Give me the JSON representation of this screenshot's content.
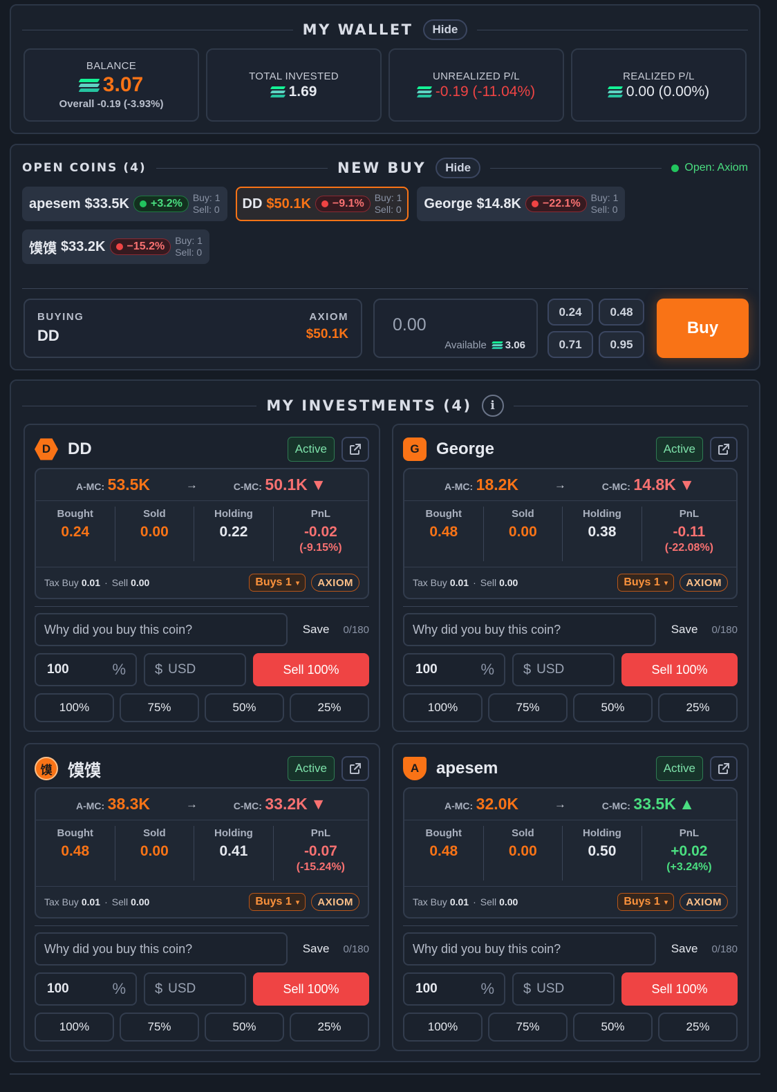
{
  "colors": {
    "accent": "#f97316",
    "negative": "#ef4444",
    "positive": "#22c55e",
    "background": "#151b24"
  },
  "wallet": {
    "title": "MY WALLET",
    "hide_label": "Hide",
    "balance": {
      "label": "BALANCE",
      "value": "3.07",
      "overall": "Overall -0.19 (-3.93%)"
    },
    "total_invested": {
      "label": "TOTAL INVESTED",
      "value": "1.69"
    },
    "unrealized": {
      "label": "UNREALIZED P/L",
      "value": "-0.19 (-11.04%)"
    },
    "realized": {
      "label": "REALIZED P/L",
      "value": "0.00 (0.00%)"
    }
  },
  "new_buy": {
    "open_coins_label": "OPEN COINS (4)",
    "title": "NEW BUY",
    "hide_label": "Hide",
    "status": "Open: Axiom",
    "coins": [
      {
        "name": "apesem",
        "mc": "$33.5K",
        "change": "+3.2%",
        "buy": "Buy: 1",
        "sell": "Sell: 0",
        "direction": "up",
        "selected": false
      },
      {
        "name": "DD",
        "mc": "$50.1K",
        "change": "−9.1%",
        "buy": "Buy: 1",
        "sell": "Sell: 0",
        "direction": "down",
        "selected": true
      },
      {
        "name": "George",
        "mc": "$14.8K",
        "change": "−22.1%",
        "buy": "Buy: 1",
        "sell": "Sell: 0",
        "direction": "down",
        "selected": false
      },
      {
        "name": "馍馍",
        "mc": "$33.2K",
        "change": "−15.2%",
        "buy": "Buy: 1",
        "sell": "Sell: 0",
        "direction": "down",
        "selected": false
      }
    ],
    "buying_label": "BUYING",
    "platform_label": "AXIOM",
    "buying_token": "DD",
    "buying_mc": "$50.1K",
    "amount_placeholder": "0.00",
    "available_label": "Available",
    "available_value": "3.06",
    "quick_amounts": [
      "0.24",
      "0.48",
      "0.71",
      "0.95"
    ],
    "buy_label": "Buy"
  },
  "investments": {
    "title": "MY INVESTMENTS (4)",
    "info_icon": "i",
    "labels": {
      "active": "Active",
      "a_mc": "A-MC:",
      "c_mc": "C-MC:",
      "bought": "Bought",
      "sold": "Sold",
      "holding": "Holding",
      "pnl": "PnL",
      "tax_buy": "Tax Buy",
      "sell": "Sell",
      "platform": "AXIOM",
      "note_placeholder": "Why did you buy this coin?",
      "save": "Save",
      "note_count": "0/180",
      "pct_unit": "%",
      "usd_symbol": "$",
      "usd": "USD",
      "sell_btn": "Sell 100%",
      "pct_options": [
        "100%",
        "75%",
        "50%",
        "25%"
      ]
    },
    "cards": [
      {
        "name": "DD",
        "icon_letter": "D",
        "a_mc": "53.5K",
        "c_mc": "50.1K",
        "trend": "down",
        "bought": "0.24",
        "sold": "0.00",
        "holding": "0.22",
        "pnl": "-0.02",
        "pnl_pct": "(-9.15%)",
        "tax_buy": "0.01",
        "tax_sell": "0.00",
        "buys": "Buys 1",
        "pct_value": "100"
      },
      {
        "name": "George",
        "icon_letter": "G",
        "a_mc": "18.2K",
        "c_mc": "14.8K",
        "trend": "down",
        "bought": "0.48",
        "sold": "0.00",
        "holding": "0.38",
        "pnl": "-0.11",
        "pnl_pct": "(-22.08%)",
        "tax_buy": "0.01",
        "tax_sell": "0.00",
        "buys": "Buys 1",
        "pct_value": "100"
      },
      {
        "name": "馍馍",
        "icon_letter": "馍",
        "a_mc": "38.3K",
        "c_mc": "33.2K",
        "trend": "down",
        "bought": "0.48",
        "sold": "0.00",
        "holding": "0.41",
        "pnl": "-0.07",
        "pnl_pct": "(-15.24%)",
        "tax_buy": "0.01",
        "tax_sell": "0.00",
        "buys": "Buys 1",
        "pct_value": "100"
      },
      {
        "name": "apesem",
        "icon_letter": "A",
        "a_mc": "32.0K",
        "c_mc": "33.5K",
        "trend": "up",
        "bought": "0.48",
        "sold": "0.00",
        "holding": "0.50",
        "pnl": "+0.02",
        "pnl_pct": "(+3.24%)",
        "tax_buy": "0.01",
        "tax_sell": "0.00",
        "buys": "Buys 1",
        "pct_value": "100"
      }
    ]
  }
}
